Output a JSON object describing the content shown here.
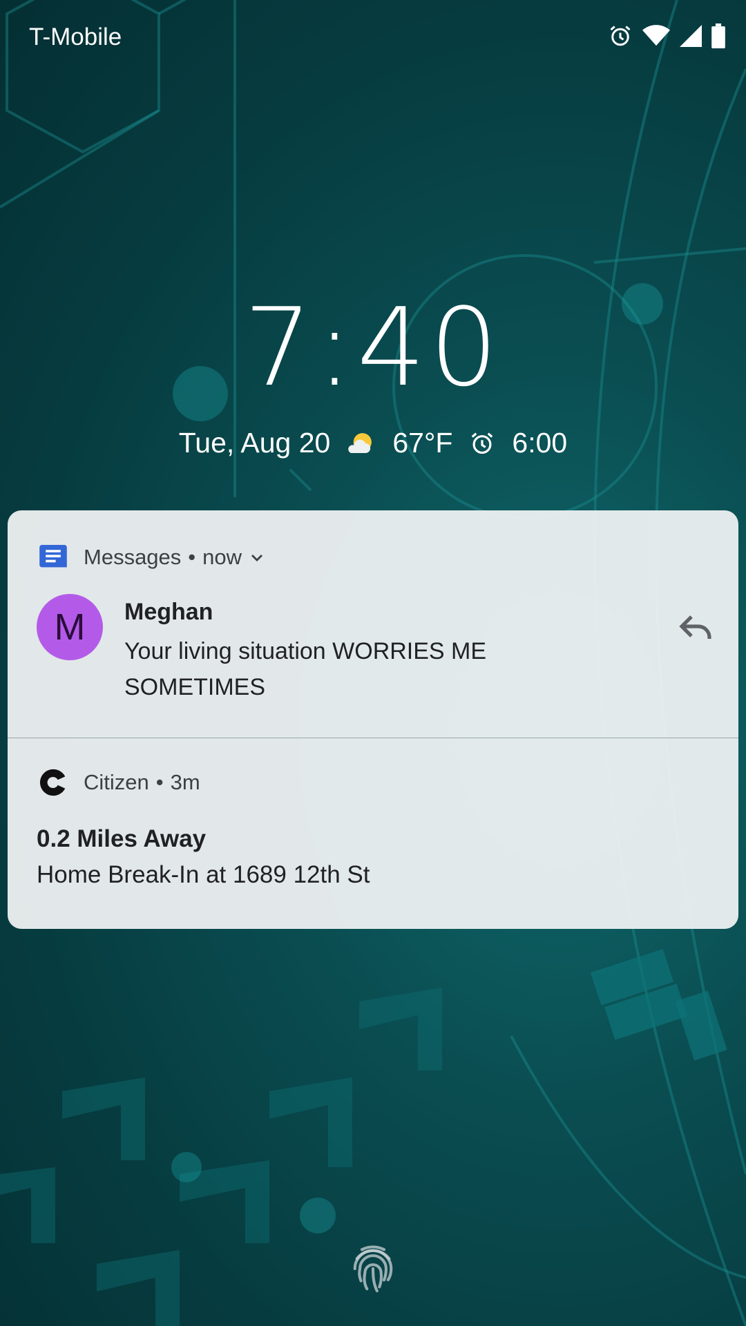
{
  "status_bar": {
    "carrier": "T-Mobile",
    "icons": [
      "alarm-icon",
      "wifi-icon",
      "cell-signal-icon",
      "battery-icon"
    ]
  },
  "lock_screen": {
    "time": "7:40",
    "date": "Tue, Aug 20",
    "weather_icon": "partly-cloudy-icon",
    "temperature": "67°F",
    "alarm_icon": "alarm-icon",
    "alarm_time": "6:00"
  },
  "notifications": [
    {
      "app": "Messages",
      "app_icon": "messages-app-icon",
      "time": "now",
      "expandable": true,
      "avatar_letter": "M",
      "avatar_color": "#b35be8",
      "sender": "Meghan",
      "message": "Your living situation WORRIES ME SOMETIMES",
      "action_icon": "reply-icon"
    },
    {
      "app": "Citizen",
      "app_icon": "citizen-app-icon",
      "time": "3m",
      "title": "0.2 Miles Away",
      "body": "Home Break-In at 1689 12th St"
    }
  ],
  "bottom": {
    "icon": "fingerprint-icon"
  },
  "colors": {
    "wallpaper_dark": "#042f33",
    "wallpaper_accent": "#0f6a6d",
    "card_background": "#f0f2f3",
    "messages_blue": "#3367d6",
    "avatar_purple": "#b35be8"
  }
}
